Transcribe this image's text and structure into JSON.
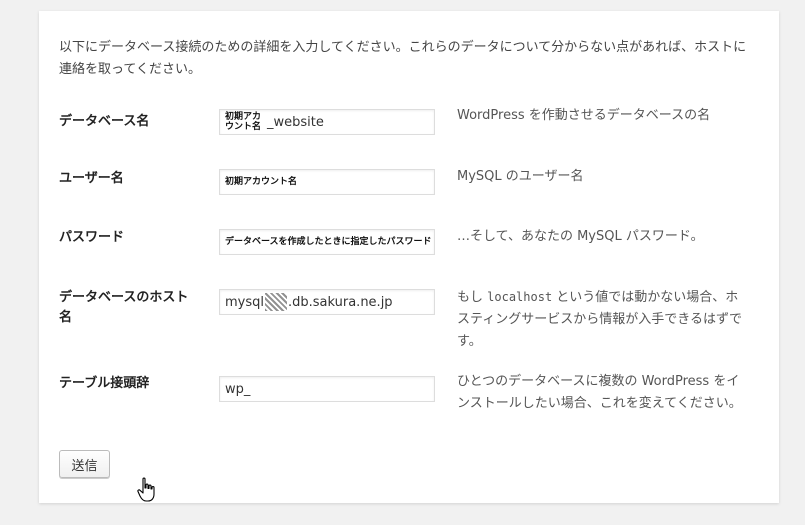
{
  "intro": "以下にデータベース接続のための詳細を入力してください。これらのデータについて分からない点があれば、ホストに連絡を取ってください。",
  "rows": [
    {
      "label": "データベース名",
      "value_small": "初期アカウント名",
      "value_main": "_website",
      "desc": "WordPress を作動させるデータベースの名"
    },
    {
      "label": "ユーザー名",
      "value_small": "初期アカウント名",
      "desc": "MySQL のユーザー名"
    },
    {
      "label": "パスワード",
      "value_small": "データベースを作成したときに指定したパスワード",
      "desc": "…そして、あなたの MySQL パスワード。"
    },
    {
      "label": "データベースのホスト名",
      "value_prefix": "mysql",
      "value_suffix": ".db.sakura.ne.jp",
      "desc_before": "もし ",
      "desc_code": "localhost",
      "desc_after": " という値では動かない場合、ホスティングサービスから情報が入手できるはずです。"
    },
    {
      "label": "テーブル接頭辞",
      "value": "wp_",
      "desc": "ひとつのデータベースに複数の WordPress をインストールしたい場合、これを変えてください。"
    }
  ],
  "submit_label": "送信",
  "icons": {
    "cursor": "hand-pointer-icon",
    "redaction": "redaction-mosaic"
  }
}
